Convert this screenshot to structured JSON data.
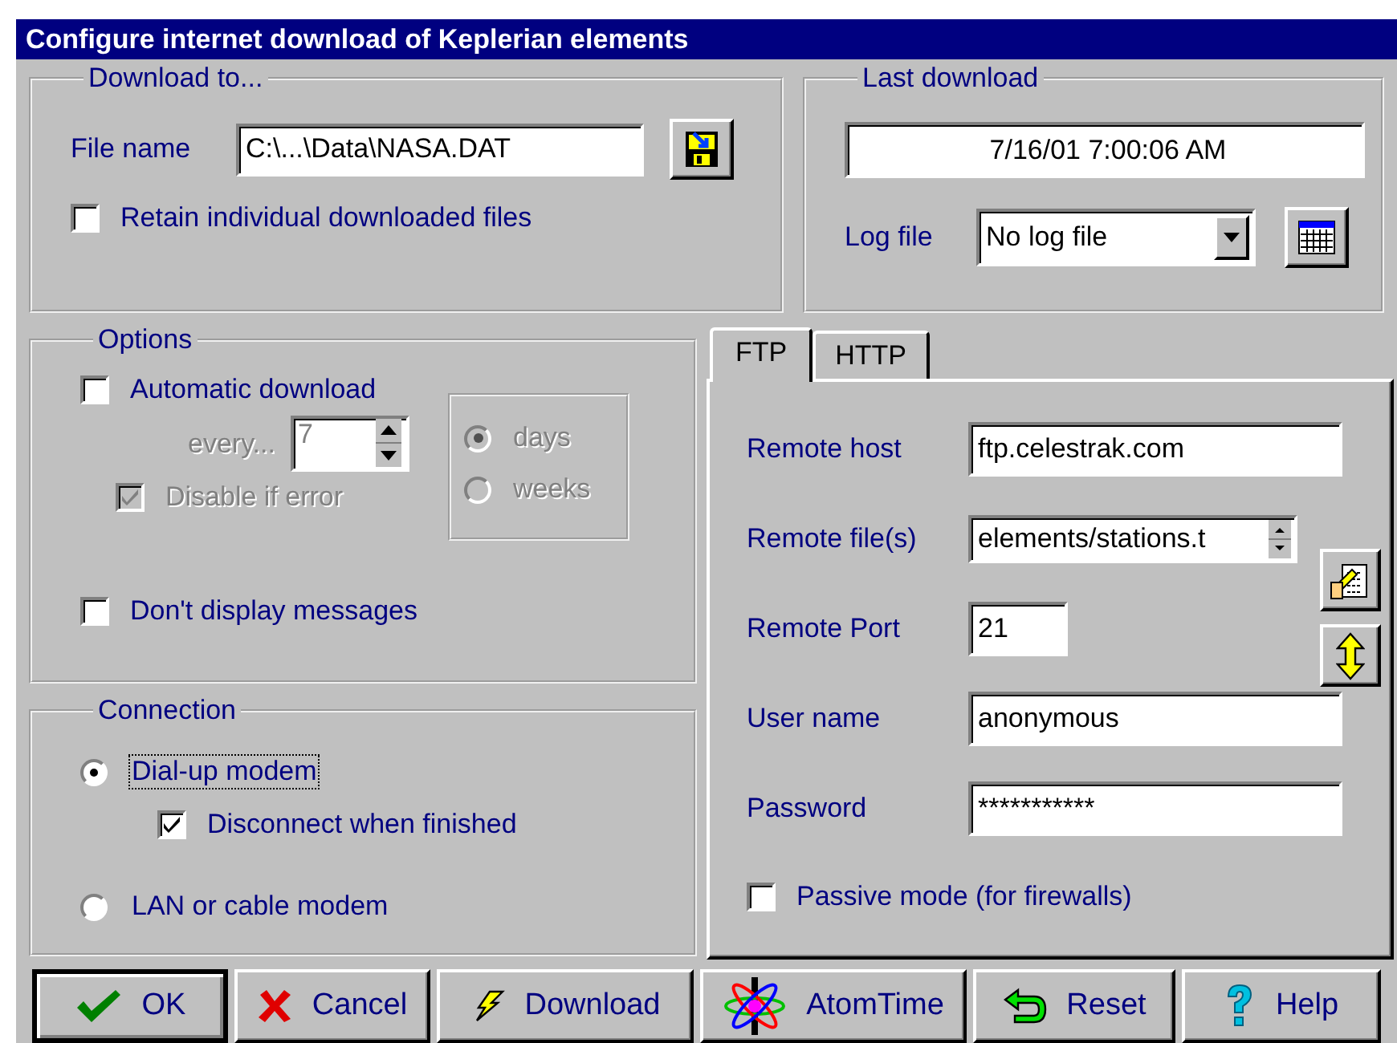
{
  "window": {
    "title": "Configure internet download of Keplerian elements"
  },
  "download_to": {
    "title": "Download to...",
    "file_name": {
      "label": "File name",
      "value": "C:\\...\\Data\\NASA.DAT"
    },
    "retain": {
      "label": "Retain individual downloaded files",
      "checked": false
    }
  },
  "last_download": {
    "title": "Last download",
    "timestamp": "7/16/01 7:00:06 AM",
    "log_file": {
      "label": "Log file",
      "value": "No log file"
    }
  },
  "options": {
    "title": "Options",
    "automatic_download": {
      "label": "Automatic download",
      "checked": false
    },
    "every": {
      "label": "every...",
      "value": "7",
      "disabled": true
    },
    "period": [
      {
        "label": "days",
        "selected": true,
        "disabled": true
      },
      {
        "label": "weeks",
        "selected": false,
        "disabled": true
      }
    ],
    "disable_if_error": {
      "label": "Disable if error",
      "checked": true,
      "disabled": true
    },
    "dont_display_messages": {
      "label": "Don't display messages",
      "checked": false
    }
  },
  "connection": {
    "title": "Connection",
    "modes": [
      {
        "label": "Dial-up modem",
        "selected": true,
        "focused": true
      },
      {
        "label": "LAN or cable modem",
        "selected": false,
        "focused": false
      }
    ],
    "disconnect": {
      "label": "Disconnect when finished",
      "checked": true
    }
  },
  "tabs": [
    {
      "label": "FTP",
      "selected": true
    },
    {
      "label": "HTTP",
      "selected": false
    }
  ],
  "ftp": {
    "fields": [
      {
        "label": "Remote host",
        "value": "ftp.celestrak.com",
        "kind": "text"
      },
      {
        "label": "Remote file(s)",
        "value": "elements/stations.t",
        "kind": "spin"
      },
      {
        "label": "Remote Port",
        "value": "21",
        "kind": "short"
      },
      {
        "label": "User name",
        "value": "anonymous",
        "kind": "text"
      },
      {
        "label": "Password",
        "value": "***********",
        "kind": "text"
      }
    ],
    "passive_mode": {
      "label": "Passive mode (for firewalls)",
      "checked": false
    }
  },
  "buttons": [
    {
      "label": "OK",
      "kind": "ok",
      "default": true
    },
    {
      "label": "Cancel",
      "kind": "cancel",
      "default": false
    },
    {
      "label": "Download",
      "kind": "download",
      "default": false
    },
    {
      "label": "AtomTime",
      "kind": "atomtime",
      "default": false
    },
    {
      "label": "Reset",
      "kind": "reset",
      "default": false
    },
    {
      "label": "Help",
      "kind": "help",
      "default": false
    }
  ]
}
